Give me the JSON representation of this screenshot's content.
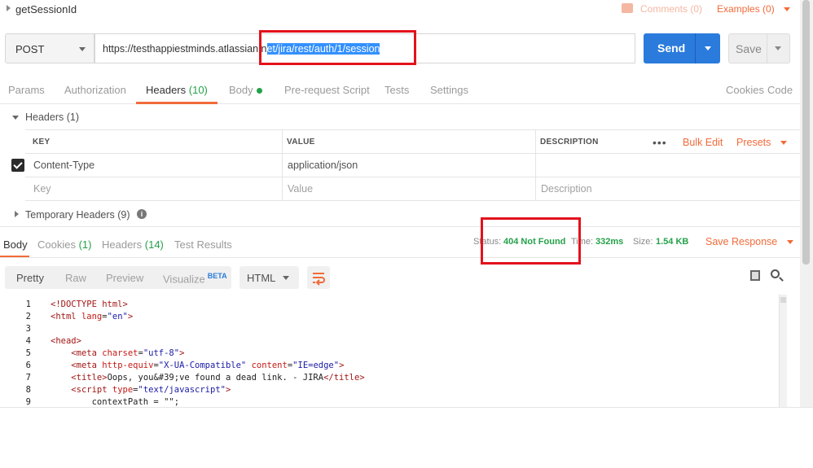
{
  "request": {
    "name": "getSessionId",
    "comments": "Comments (0)",
    "examples": "Examples (0)",
    "method": "POST",
    "url_plain": "https://testhappiestminds.atlassian.n",
    "url_selected": "et/jira/rest/auth/1/session",
    "send": "Send",
    "save": "Save"
  },
  "request_tabs": [
    {
      "label": "Params",
      "count": ""
    },
    {
      "label": "Authorization",
      "count": ""
    },
    {
      "label": "Headers",
      "count": "(10)"
    },
    {
      "label": "Body",
      "count": ""
    },
    {
      "label": "Pre-request Script",
      "count": ""
    },
    {
      "label": "Tests",
      "count": ""
    },
    {
      "label": "Settings",
      "count": ""
    }
  ],
  "request_links": {
    "cookies": "Cookies",
    "code": "Code"
  },
  "headers_section": {
    "title": "Headers (1)",
    "columns": [
      "KEY",
      "VALUE",
      "DESCRIPTION"
    ],
    "bulk_edit": "Bulk Edit",
    "presets": "Presets",
    "rows": [
      {
        "key": "Content-Type",
        "value": "application/json",
        "description": ""
      }
    ],
    "placeholder": {
      "key": "Key",
      "value": "Value",
      "description": "Description"
    },
    "temporary": "Temporary Headers (9)"
  },
  "response": {
    "tabs": [
      {
        "label": "Body",
        "count": ""
      },
      {
        "label": "Cookies",
        "count": "(1)"
      },
      {
        "label": "Headers",
        "count": "(14)"
      },
      {
        "label": "Test Results",
        "count": ""
      }
    ],
    "status_label": "Status:",
    "status_value": "404 Not Found",
    "time_label": "Time:",
    "time_value": "332ms",
    "size_label": "Size:",
    "size_value": "1.54 KB",
    "save_response": "Save Response"
  },
  "view_toolbar": {
    "modes": [
      "Pretty",
      "Raw",
      "Preview",
      "Visualize"
    ],
    "beta": "BETA",
    "format": "HTML"
  },
  "code_lines": [
    {
      "n": "1",
      "parts": [
        [
          "tag",
          "<!DOCTYPE html>"
        ]
      ]
    },
    {
      "n": "2",
      "parts": [
        [
          "tag",
          "<html "
        ],
        [
          "attr",
          "lang"
        ],
        [
          "txt",
          "="
        ],
        [
          "aval",
          "\"en\""
        ],
        [
          "tag",
          ">"
        ]
      ]
    },
    {
      "n": "3",
      "parts": []
    },
    {
      "n": "4",
      "parts": [
        [
          "tag",
          "<head>"
        ]
      ]
    },
    {
      "n": "5",
      "parts": [
        [
          "txt",
          "    "
        ],
        [
          "tag",
          "<meta "
        ],
        [
          "attr",
          "charset"
        ],
        [
          "txt",
          "="
        ],
        [
          "aval",
          "\"utf-8\""
        ],
        [
          "tag",
          ">"
        ]
      ]
    },
    {
      "n": "6",
      "parts": [
        [
          "txt",
          "    "
        ],
        [
          "tag",
          "<meta "
        ],
        [
          "attr",
          "http-equiv"
        ],
        [
          "txt",
          "="
        ],
        [
          "aval",
          "\"X-UA-Compatible\""
        ],
        [
          "txt",
          " "
        ],
        [
          "attr",
          "content"
        ],
        [
          "txt",
          "="
        ],
        [
          "aval",
          "\"IE=edge\""
        ],
        [
          "tag",
          ">"
        ]
      ]
    },
    {
      "n": "7",
      "parts": [
        [
          "txt",
          "    "
        ],
        [
          "tag",
          "<title>"
        ],
        [
          "txt",
          "Oops, you&#39;ve found a dead link. - JIRA"
        ],
        [
          "tag",
          "</title>"
        ]
      ]
    },
    {
      "n": "8",
      "parts": [
        [
          "txt",
          "    "
        ],
        [
          "tag",
          "<script "
        ],
        [
          "attr",
          "type"
        ],
        [
          "txt",
          "="
        ],
        [
          "aval",
          "\"text/javascript\""
        ],
        [
          "tag",
          ">"
        ]
      ]
    },
    {
      "n": "9",
      "parts": [
        [
          "txt",
          "        contextPath = \"\";"
        ]
      ]
    }
  ]
}
